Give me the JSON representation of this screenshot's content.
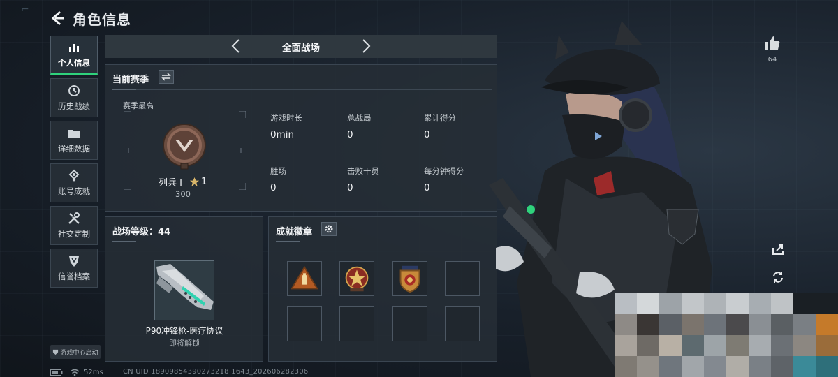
{
  "header": {
    "title": "角色信息"
  },
  "sidebar": {
    "items": [
      {
        "label": "个人信息",
        "icon": "bar-chart-icon",
        "active": true
      },
      {
        "label": "历史战绩",
        "icon": "clock-icon",
        "active": false
      },
      {
        "label": "详细数据",
        "icon": "folder-icon",
        "active": false
      },
      {
        "label": "账号成就",
        "icon": "achievement-icon",
        "active": false
      },
      {
        "label": "社交定制",
        "icon": "tools-icon",
        "active": false
      },
      {
        "label": "信誉档案",
        "icon": "shield-icon",
        "active": false
      }
    ],
    "launch_badge": "游戏中心启动"
  },
  "mode_bar": {
    "title": "全面战场"
  },
  "season": {
    "title": "当前赛季",
    "best_label": "赛季最高",
    "rank_name": "列兵 Ⅰ",
    "rank_stars": "1",
    "rank_score": "300",
    "stats": [
      {
        "label": "游戏时长",
        "value": "0min"
      },
      {
        "label": "总战局",
        "value": "0"
      },
      {
        "label": "累计得分",
        "value": "0"
      },
      {
        "label": "胜场",
        "value": "0"
      },
      {
        "label": "击败干员",
        "value": "0"
      },
      {
        "label": "每分钟得分",
        "value": "0"
      }
    ]
  },
  "battlefield": {
    "title": "战场等级：44",
    "weapon_name": "P90冲锋枪-医疗协议",
    "weapon_status": "即将解锁"
  },
  "achievements": {
    "title": "成就徽章",
    "badges": [
      "triangle-badge",
      "star-emblem-badge",
      "police-shield-badge",
      "",
      "",
      "",
      "",
      ""
    ]
  },
  "social": {
    "likes": "64"
  },
  "status": {
    "ping": "52ms",
    "uid": "CN UID 18909854390273218 1643_202606282306"
  },
  "colors": {
    "accent": "#2fd27c",
    "panel": "#262e35",
    "background": "#141a20"
  }
}
